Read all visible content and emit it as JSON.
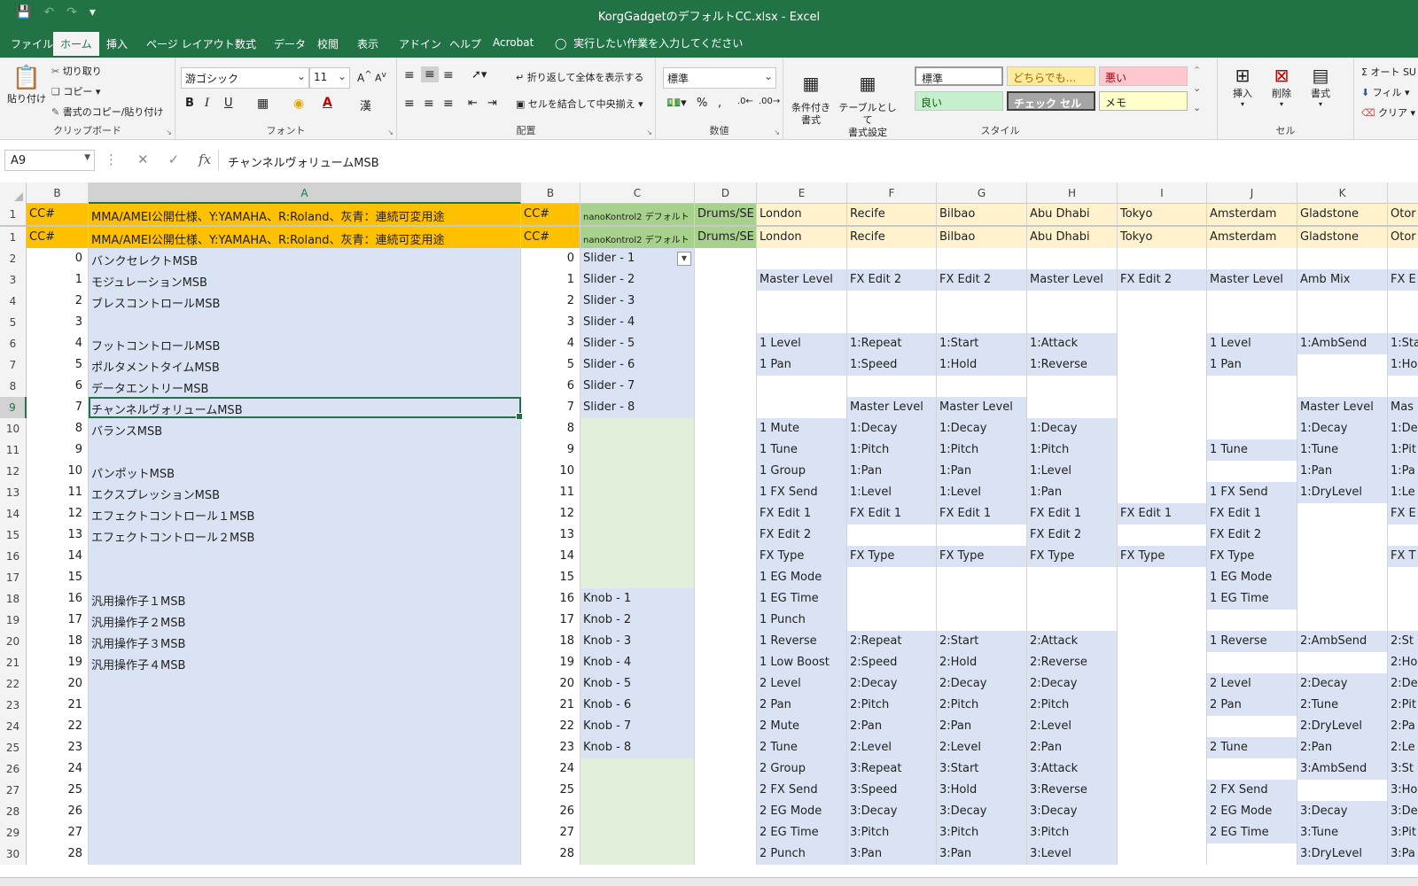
{
  "titlebar": {
    "doc_title": "KorgGadgetのデフォルトCC.xlsx  -  Excel"
  },
  "tabs": {
    "file": "ファイル",
    "home": "ホーム",
    "insert": "挿入",
    "layout": "ページ レイアウト",
    "formulas": "数式",
    "data": "データ",
    "review": "校閲",
    "view": "表示",
    "addins": "アドイン",
    "help": "ヘルプ",
    "acrobat": "Acrobat",
    "tellme": "実行したい作業を入力してください"
  },
  "ribbon": {
    "clipboard": {
      "paste": "貼り付け",
      "cut": "切り取り",
      "copy": "コピー",
      "format_painter": "書式のコピー/貼り付け",
      "label": "クリップボード"
    },
    "font": {
      "name": "游ゴシック",
      "size": "11",
      "label": "フォント",
      "bold": "B",
      "italic": "I",
      "underline": "U"
    },
    "alignment": {
      "wrap": "折り返して全体を表示する",
      "merge": "セルを結合して中央揃え",
      "label": "配置"
    },
    "number": {
      "format": "標準",
      "label": "数値"
    },
    "styles": {
      "conditional": "条件付き\n書式",
      "as_table": "テーブルとして\n書式設定",
      "cells": [
        "標準",
        "どちらでも...",
        "悪い",
        "良い",
        "チェック セル",
        "メモ"
      ],
      "label": "スタイル"
    },
    "cells": {
      "insert": "挿入",
      "delete": "削除",
      "format": "書式",
      "label": "セル"
    },
    "editing": {
      "autosum": "オート SU",
      "fill": "フィル",
      "clear": "クリア"
    }
  },
  "formula_bar": {
    "name_box": "A9",
    "formula": "チャンネルヴォリュームMSB"
  },
  "colors": {
    "excel_green": "#217346",
    "header_orange": "#ffc000",
    "header_green": "#a9d18e",
    "city_yellow": "#fff2cc",
    "light_blue": "#dae3f3",
    "light_green": "#e2efda"
  },
  "grid": {
    "column_headers": [
      "B",
      "A",
      "B",
      "C",
      "D",
      "E",
      "F",
      "G",
      "H",
      "I",
      "J",
      "K",
      ""
    ],
    "header_row": {
      "row_label": "1",
      "cells": [
        "CC#",
        "MMA/AMEI公開仕様、Y:YAMAHA、R:Roland、灰青：連続可変用途",
        "CC#",
        "nanoKontrol2 デフォルト",
        "Drums/SE",
        "London",
        "Recife",
        "Bilbao",
        "Abu Dhabi",
        "Tokyo",
        "Amsterdam",
        "Gladstone",
        "Otor"
      ]
    },
    "rows": [
      {
        "r": "1",
        "cells": [
          "CC#",
          "MMA/AMEI公開仕様、Y:YAMAHA、R:Roland、灰青：連続可変用途",
          "CC#",
          "nanoKontrol2 デフォルト",
          "Drums/SE",
          "London",
          "Recife",
          "Bilbao",
          "Abu Dhabi",
          "Tokyo",
          "Amsterdam",
          "Gladstone",
          "Otor"
        ]
      },
      {
        "r": "2",
        "cells": [
          "0",
          "バンクセレクトMSB",
          "0",
          "Slider - 1",
          "",
          "",
          "",
          "",
          "",
          "",
          "",
          "",
          ""
        ]
      },
      {
        "r": "3",
        "cells": [
          "1",
          "モジュレーションMSB",
          "1",
          "Slider - 2",
          "",
          "Master Level",
          "FX Edit 2",
          "FX Edit 2",
          "Master Level",
          "FX Edit 2",
          "Master Level",
          "Amb Mix",
          "FX E"
        ]
      },
      {
        "r": "4",
        "cells": [
          "2",
          "ブレスコントロールMSB",
          "2",
          "Slider - 3",
          "",
          "",
          "",
          "",
          "",
          "",
          "",
          "",
          ""
        ]
      },
      {
        "r": "5",
        "cells": [
          "3",
          "",
          "3",
          "Slider - 4",
          "",
          "",
          "",
          "",
          "",
          "",
          "",
          "",
          ""
        ]
      },
      {
        "r": "6",
        "cells": [
          "4",
          "フットコントロールMSB",
          "4",
          "Slider - 5",
          "",
          "1 Level",
          "1:Repeat",
          "1:Start",
          "1:Attack",
          "",
          "1 Level",
          "1:AmbSend",
          "1:Sta"
        ]
      },
      {
        "r": "7",
        "cells": [
          "5",
          "ポルタメントタイムMSB",
          "5",
          "Slider - 6",
          "",
          "1 Pan",
          "1:Speed",
          "1:Hold",
          "1:Reverse",
          "",
          "1 Pan",
          "",
          "1:Ho"
        ]
      },
      {
        "r": "8",
        "cells": [
          "6",
          "データエントリーMSB",
          "6",
          "Slider - 7",
          "",
          "",
          "",
          "",
          "",
          "",
          "",
          "",
          ""
        ]
      },
      {
        "r": "9",
        "cells": [
          "7",
          "チャンネルヴォリュームMSB",
          "7",
          "Slider - 8",
          "",
          "",
          "Master Level",
          "Master Level",
          "",
          "",
          "",
          "Master Level",
          "Mas"
        ]
      },
      {
        "r": "10",
        "cells": [
          "8",
          "バランスMSB",
          "8",
          "",
          "",
          "1 Mute",
          "1:Decay",
          "1:Decay",
          "1:Decay",
          "",
          "",
          "1:Decay",
          "1:De"
        ]
      },
      {
        "r": "11",
        "cells": [
          "9",
          "",
          "9",
          "",
          "",
          "1 Tune",
          "1:Pitch",
          "1:Pitch",
          "1:Pitch",
          "",
          "1 Tune",
          "1:Tune",
          "1:Pit"
        ]
      },
      {
        "r": "12",
        "cells": [
          "10",
          "パンポットMSB",
          "10",
          "",
          "",
          "1 Group",
          "1:Pan",
          "1:Pan",
          "1:Level",
          "",
          "",
          "1:Pan",
          "1:Pa"
        ]
      },
      {
        "r": "13",
        "cells": [
          "11",
          "エクスプレッションMSB",
          "11",
          "",
          "",
          "1 FX Send",
          "1:Level",
          "1:Level",
          "1:Pan",
          "",
          "1 FX Send",
          "1:DryLevel",
          "1:Le"
        ]
      },
      {
        "r": "14",
        "cells": [
          "12",
          "エフェクトコントロール１MSB",
          "12",
          "",
          "",
          "FX Edit 1",
          "FX Edit 1",
          "FX Edit 1",
          "FX Edit 1",
          "FX Edit 1",
          "FX Edit 1",
          "",
          "FX E"
        ]
      },
      {
        "r": "15",
        "cells": [
          "13",
          "エフェクトコントロール２MSB",
          "13",
          "",
          "",
          "FX Edit 2",
          "",
          "",
          "FX Edit 2",
          "",
          "FX Edit 2",
          "",
          ""
        ]
      },
      {
        "r": "16",
        "cells": [
          "14",
          "",
          "14",
          "",
          "",
          "FX Type",
          "FX Type",
          "FX Type",
          "FX Type",
          "FX Type",
          "FX Type",
          "",
          "FX T"
        ]
      },
      {
        "r": "17",
        "cells": [
          "15",
          "",
          "15",
          "",
          "",
          "1 EG Mode",
          "",
          "",
          "",
          "",
          "1 EG Mode",
          "",
          ""
        ]
      },
      {
        "r": "18",
        "cells": [
          "16",
          "汎用操作子１MSB",
          "16",
          "Knob - 1",
          "",
          "1 EG Time",
          "",
          "",
          "",
          "",
          "1 EG Time",
          "",
          ""
        ]
      },
      {
        "r": "19",
        "cells": [
          "17",
          "汎用操作子２MSB",
          "17",
          "Knob - 2",
          "",
          "1 Punch",
          "",
          "",
          "",
          "",
          "",
          "",
          ""
        ]
      },
      {
        "r": "20",
        "cells": [
          "18",
          "汎用操作子３MSB",
          "18",
          "Knob - 3",
          "",
          "1 Reverse",
          "2:Repeat",
          "2:Start",
          "2:Attack",
          "",
          "1 Reverse",
          "2:AmbSend",
          "2:St"
        ]
      },
      {
        "r": "21",
        "cells": [
          "19",
          "汎用操作子４MSB",
          "19",
          "Knob - 4",
          "",
          "1 Low Boost",
          "2:Speed",
          "2:Hold",
          "2:Reverse",
          "",
          "",
          "",
          "2:Ho"
        ]
      },
      {
        "r": "22",
        "cells": [
          "20",
          "",
          "20",
          "Knob - 5",
          "",
          "2 Level",
          "2:Decay",
          "2:Decay",
          "2:Decay",
          "",
          "2 Level",
          "2:Decay",
          "2:De"
        ]
      },
      {
        "r": "23",
        "cells": [
          "21",
          "",
          "21",
          "Knob - 6",
          "",
          "2 Pan",
          "2:Pitch",
          "2:Pitch",
          "2:Pitch",
          "",
          "2 Pan",
          "2:Tune",
          "2:Pit"
        ]
      },
      {
        "r": "24",
        "cells": [
          "22",
          "",
          "22",
          "Knob - 7",
          "",
          "2 Mute",
          "2:Pan",
          "2:Pan",
          "2:Level",
          "",
          "",
          "2:DryLevel",
          "2:Pa"
        ]
      },
      {
        "r": "25",
        "cells": [
          "23",
          "",
          "23",
          "Knob - 8",
          "",
          "2 Tune",
          "2:Level",
          "2:Level",
          "2:Pan",
          "",
          "2 Tune",
          "2:Pan",
          "2:Le"
        ]
      },
      {
        "r": "26",
        "cells": [
          "24",
          "",
          "24",
          "",
          "",
          "2 Group",
          "3:Repeat",
          "3:Start",
          "3:Attack",
          "",
          "",
          "3:AmbSend",
          "3:St"
        ]
      },
      {
        "r": "27",
        "cells": [
          "25",
          "",
          "25",
          "",
          "",
          "2 FX Send",
          "3:Speed",
          "3:Hold",
          "3:Reverse",
          "",
          "2 FX Send",
          "",
          "3:Ho"
        ]
      },
      {
        "r": "28",
        "cells": [
          "26",
          "",
          "26",
          "",
          "",
          "2 EG Mode",
          "3:Decay",
          "3:Decay",
          "3:Decay",
          "",
          "2 EG Mode",
          "3:Decay",
          "3:De"
        ]
      },
      {
        "r": "29",
        "cells": [
          "27",
          "",
          "27",
          "",
          "",
          "2 EG Time",
          "3:Pitch",
          "3:Pitch",
          "3:Pitch",
          "",
          "2 EG Time",
          "3:Tune",
          "3:Pit"
        ]
      },
      {
        "r": "30",
        "cells": [
          "28",
          "",
          "28",
          "",
          "",
          "2 Punch",
          "3:Pan",
          "3:Pan",
          "3:Level",
          "",
          "",
          "3:DryLevel",
          "3:Pa"
        ]
      }
    ]
  }
}
